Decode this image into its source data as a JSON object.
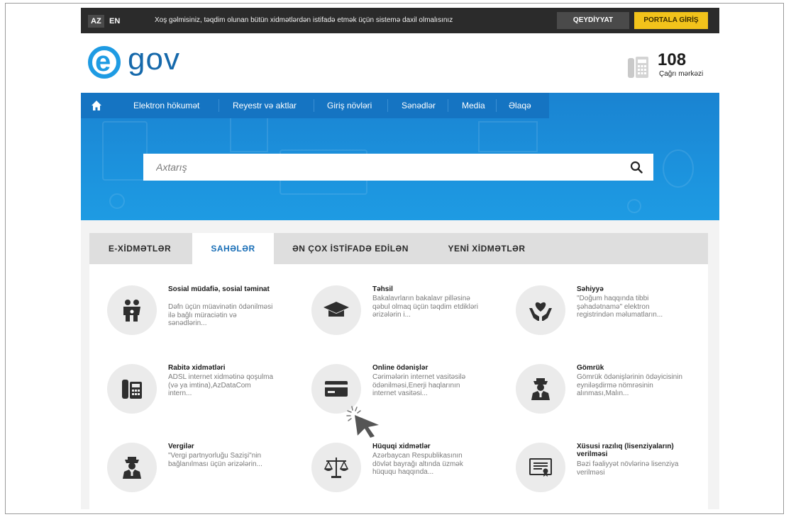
{
  "topbar": {
    "lang_az": "AZ",
    "lang_en": "EN",
    "welcome": "Xoş gəlmisiniz, təqdim olunan bütün xidmətlərdən istifadə etmək üçün sistemə daxil olmalısınız",
    "register_label": "QEYDİYYAT",
    "portal_login_label": "PORTALA GİRİŞ"
  },
  "header": {
    "logo_letter": "e",
    "logo_text": "gov",
    "hotline_number": "108",
    "hotline_label": "Çağrı mərkəzi"
  },
  "nav": {
    "items": [
      "Elektron hökumət",
      "Reyestr və aktlar",
      "Giriş növləri",
      "Sənədlər",
      "Media",
      "Əlaqə"
    ]
  },
  "search": {
    "placeholder": "Axtarış"
  },
  "tabs": [
    {
      "label": "E-XİDMƏTLƏR",
      "active": false
    },
    {
      "label": "SAHƏLƏR",
      "active": true
    },
    {
      "label": "ƏN ÇOX İSTİFADƏ EDİLƏN",
      "active": false
    },
    {
      "label": "YENİ XİDMƏTLƏR",
      "active": false
    }
  ],
  "services": [
    {
      "title": "Sosial müdafiə, sosial təminat",
      "desc": "Dəfn üçün müavinətin ödənilməsi ilə bağlı müraciətin və sənədlərin...",
      "icon": "family-icon"
    },
    {
      "title": "Təhsil",
      "desc": "Bakalavrların bakalavr pilləsinə qəbul olmaq üçün təqdim etdikləri ərizələrin i...",
      "icon": "graduation-cap-icon"
    },
    {
      "title": "Səhiyyə",
      "desc": "\"Doğum haqqında tibbi şəhadətnamə\" elektron registrindən məlumatların...",
      "icon": "heart-hands-icon"
    },
    {
      "title": "Rabitə xidmətləri",
      "desc": "ADSL internet xidmətinə qoşulma (və ya imtina),AzDataCom intern...",
      "icon": "office-phone-icon"
    },
    {
      "title": "Online ödənişlər",
      "desc": "Cərimələrin internet vasitəsilə ödənilməsi,Enerji haqlarının internet vasitəsi...",
      "icon": "credit-card-icon"
    },
    {
      "title": "Gömrük",
      "desc": "Gömrük ödənişlərinin ödəyicisinin eyniləşdirmə nömrəsinin alınması,Malın...",
      "icon": "customs-officer-icon"
    },
    {
      "title": "Vergilər",
      "desc": "\"Vergi partnyorluğu Sazişi\"nin bağlanılması üçün ərizələrin...",
      "icon": "tax-officer-icon"
    },
    {
      "title": "Hüquqi xidmətlər",
      "desc": "Azərbaycan Respublikasının dövlət bayrağı altında üzmək hüququ haqqında...",
      "icon": "scales-icon"
    },
    {
      "title": "Xüsusi razılıq (lisenziyaların) verilməsi",
      "desc": "Bəzi fəaliyyət növlərinə lisenziya verilməsi",
      "icon": "certificate-icon"
    }
  ],
  "colors": {
    "accent_blue": "#1e9be3",
    "nav_blue": "#1574c2",
    "topbar_dark": "#2b2b2b",
    "portal_yellow": "#f2c31b"
  }
}
